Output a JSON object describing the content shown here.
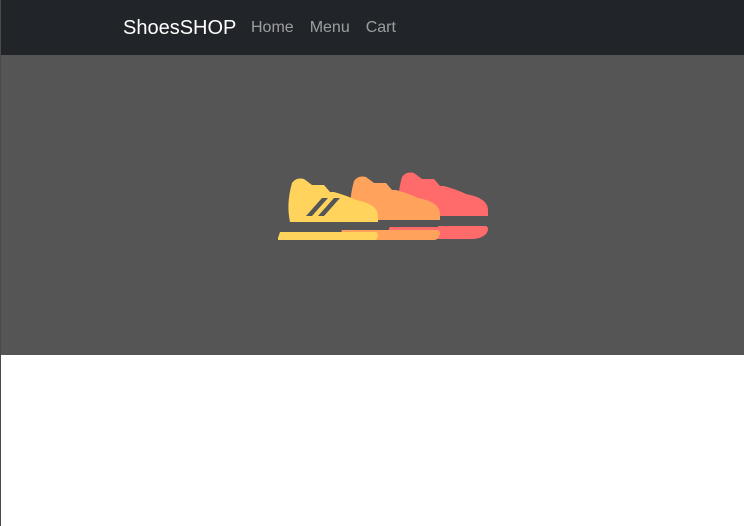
{
  "navbar": {
    "brand": "ShoesSHOP",
    "links": [
      {
        "label": "Home"
      },
      {
        "label": "Menu"
      },
      {
        "label": "Cart"
      }
    ],
    "background": "#212529"
  },
  "hero": {
    "background": "#555555",
    "icon": "sneakers-logo-icon",
    "colors": [
      "#ffd35c",
      "#ffa25c",
      "#ff6b6b"
    ]
  }
}
